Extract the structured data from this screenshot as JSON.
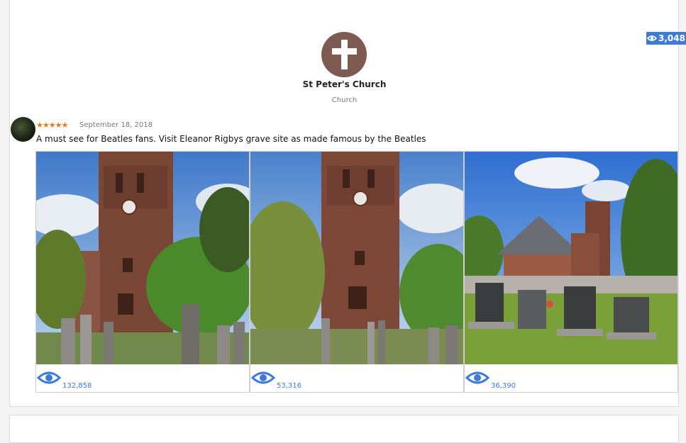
{
  "header": {
    "views_badge": "3,048"
  },
  "place": {
    "name": "St Peter's Church",
    "type": "Church",
    "icon": "cross-icon",
    "icon_color": "#7f5a51"
  },
  "review": {
    "stars": "★★★★★",
    "date": "September 18, 2018",
    "text": "A must see for Beatles fans. Visit Eleanor Rigbys grave site as made famous by the Beatles"
  },
  "photos": [
    {
      "views": "132,858"
    },
    {
      "views": "53,316"
    },
    {
      "views": "36,390"
    }
  ],
  "colors": {
    "accent": "#3f7bd6",
    "stars": "#e07b17"
  }
}
